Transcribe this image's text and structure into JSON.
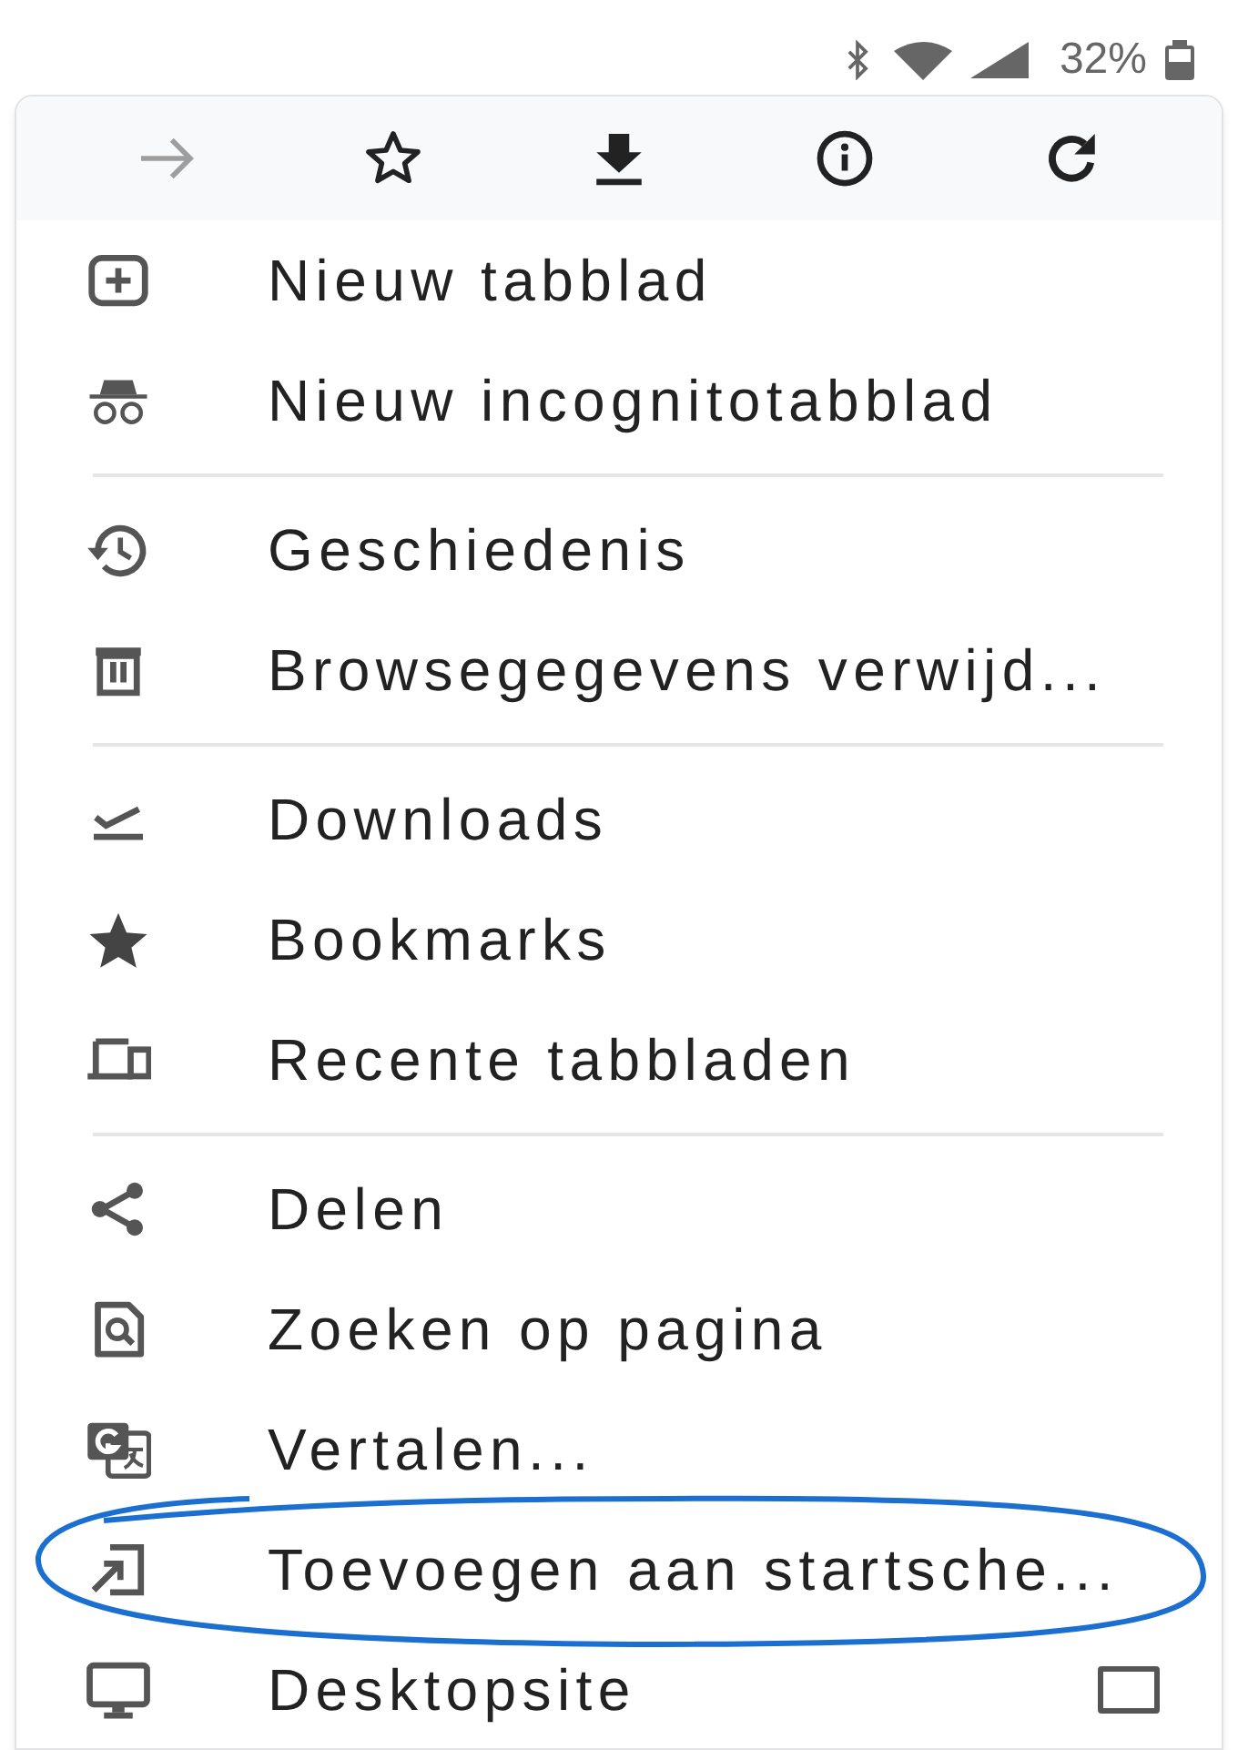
{
  "status_bar": {
    "battery": "32%"
  },
  "toolbar": [
    {
      "kind": "forward",
      "disabled": true
    },
    {
      "kind": "bookmark",
      "disabled": false
    },
    {
      "kind": "download",
      "disabled": false
    },
    {
      "kind": "info",
      "disabled": false
    },
    {
      "kind": "reload",
      "disabled": false
    }
  ],
  "menu": [
    {
      "kind": "new-tab",
      "label": "Nieuw tabblad",
      "circled": false
    },
    {
      "kind": "incognito",
      "label": "Nieuw incognitotabblad",
      "circled": false
    },
    {
      "kind": "divider"
    },
    {
      "kind": "history",
      "label": "Geschiedenis",
      "circled": false
    },
    {
      "kind": "clear",
      "label": "Browsegegevens verwijd...",
      "circled": false
    },
    {
      "kind": "divider"
    },
    {
      "kind": "downloads",
      "label": "Downloads",
      "circled": false
    },
    {
      "kind": "bookmarks",
      "label": "Bookmarks",
      "circled": false
    },
    {
      "kind": "recent",
      "label": "Recente tabbladen",
      "circled": false
    },
    {
      "kind": "divider"
    },
    {
      "kind": "share",
      "label": "Delen",
      "circled": false
    },
    {
      "kind": "find",
      "label": "Zoeken op pagina",
      "circled": false
    },
    {
      "kind": "translate",
      "label": "Vertalen...",
      "circled": false
    },
    {
      "kind": "add-home",
      "label": "Toevoegen aan startsche...",
      "circled": true
    },
    {
      "kind": "desktop",
      "label": "Desktopsite",
      "circled": false,
      "checked": false
    }
  ]
}
